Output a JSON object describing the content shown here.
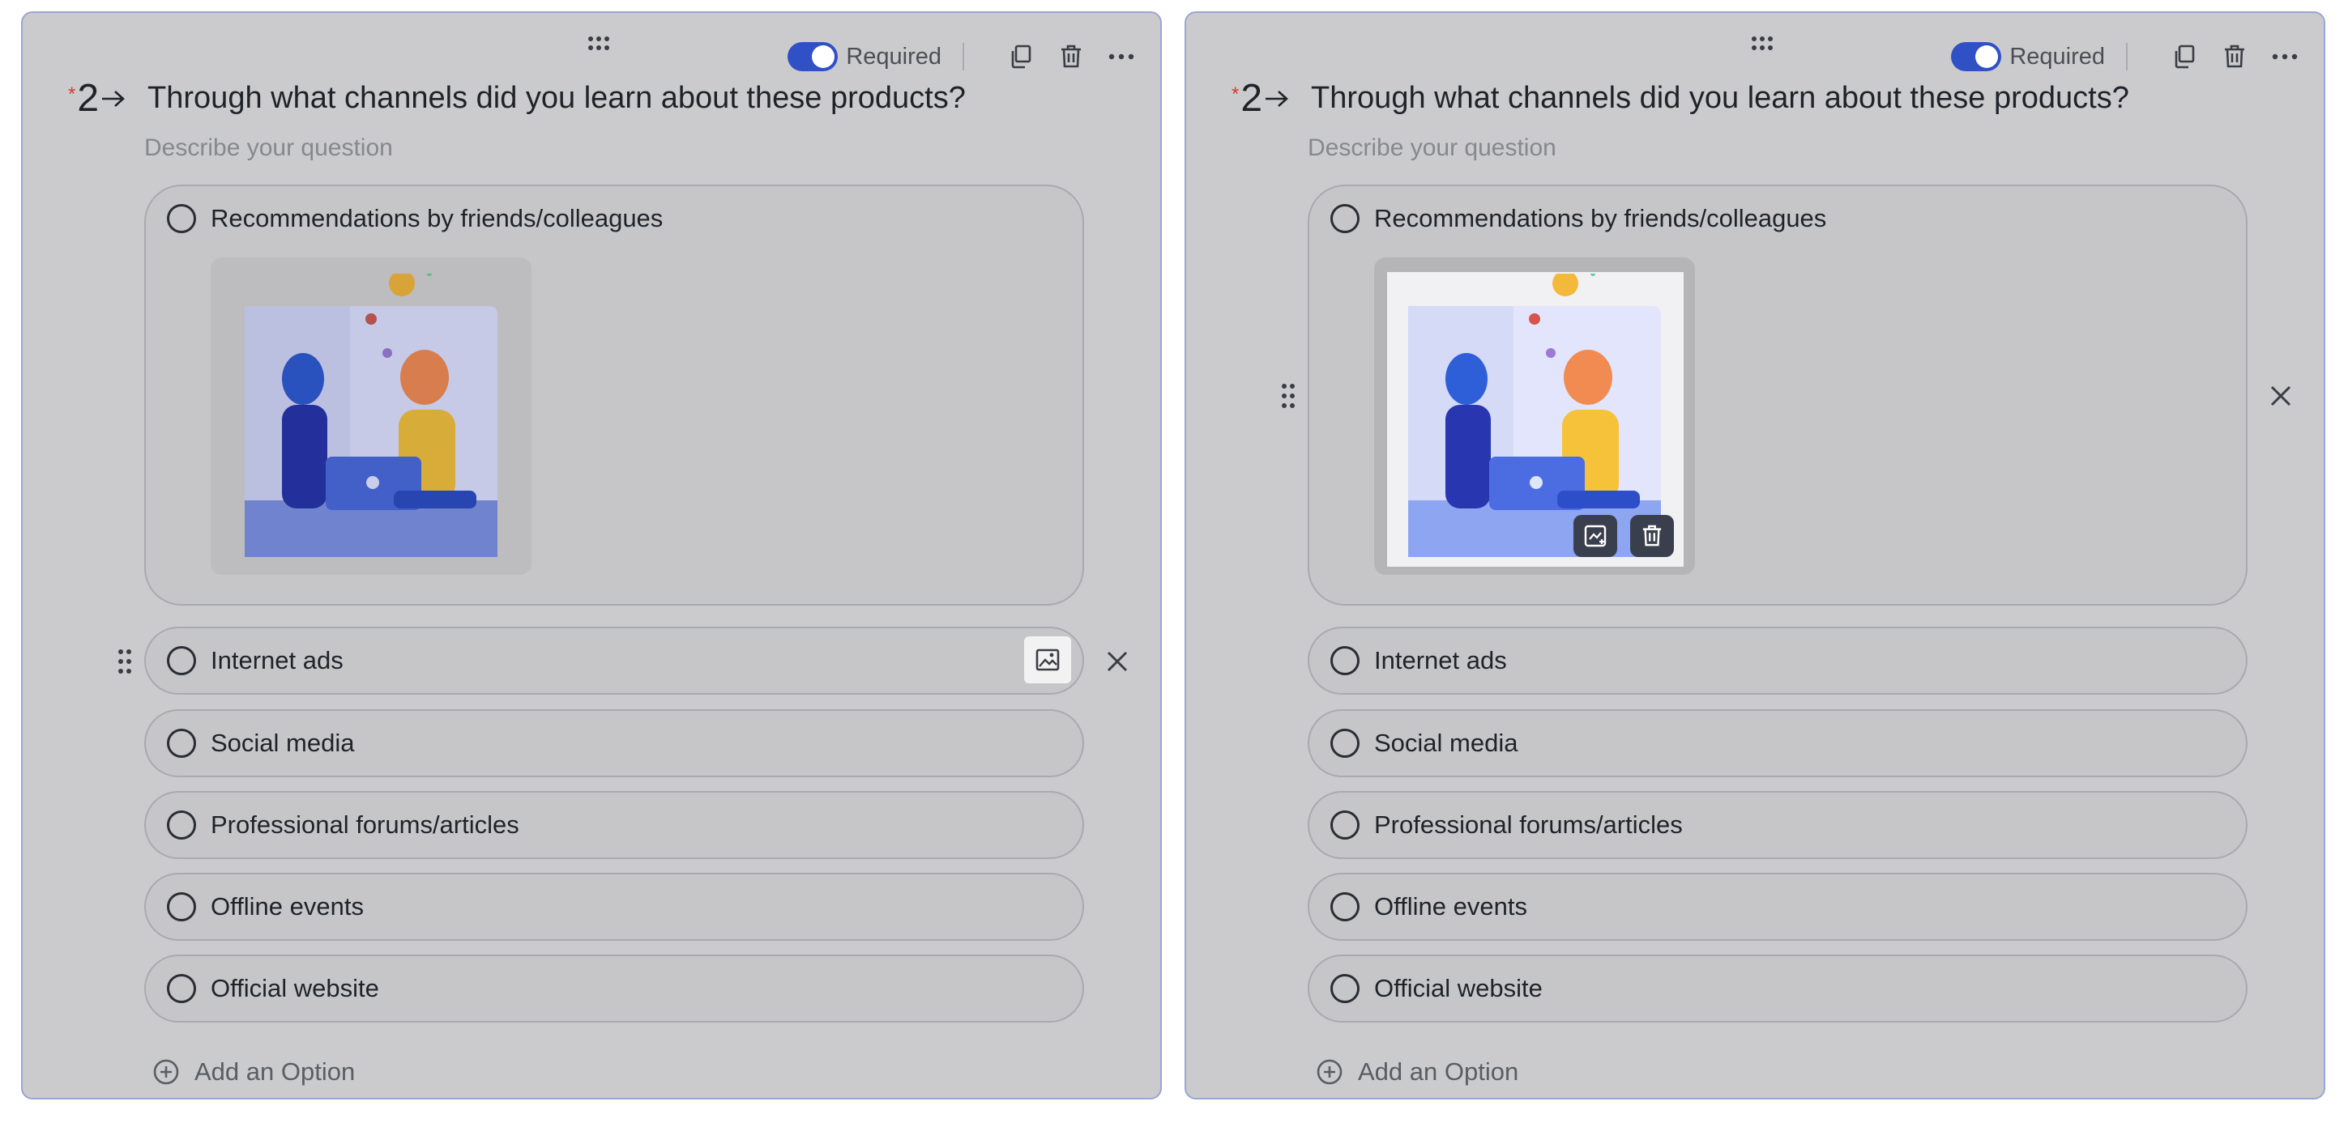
{
  "panels": [
    {
      "required_label": "Required",
      "required_on": true,
      "question_number": "2",
      "question_title": "Through what channels did you learn about these products?",
      "question_description": "Describe your question",
      "options": [
        {
          "label": "Recommendations by friends/colleagues",
          "has_image": true
        },
        {
          "label": "Internet ads",
          "has_image": false
        },
        {
          "label": "Social media",
          "has_image": false
        },
        {
          "label": "Professional forums/articles",
          "has_image": false
        },
        {
          "label": "Offline events",
          "has_image": false
        },
        {
          "label": "Official website",
          "has_image": false
        }
      ],
      "hovered_option": "Internet ads",
      "add_option_label": "Add an Option"
    },
    {
      "required_label": "Required",
      "required_on": true,
      "question_number": "2",
      "question_title": "Through what channels did you learn about these products?",
      "question_description": "Describe your question",
      "options": [
        {
          "label": "Recommendations by friends/colleagues",
          "has_image": true
        },
        {
          "label": "Internet ads",
          "has_image": false
        },
        {
          "label": "Social media",
          "has_image": false
        },
        {
          "label": "Professional forums/articles",
          "has_image": false
        },
        {
          "label": "Offline events",
          "has_image": false
        },
        {
          "label": "Official website",
          "has_image": false
        }
      ],
      "hovered_option": "Recommendations by friends/colleagues",
      "image_tools": [
        "replace-image-icon",
        "delete-image-icon"
      ],
      "add_option_label": "Add an Option"
    }
  ],
  "icons": [
    "drag-handle-icon",
    "copy-icon",
    "trash-icon",
    "more-icon",
    "arrow-right-icon",
    "image-icon",
    "close-icon",
    "plus-circle-icon"
  ],
  "colors": {
    "accent": "#3050c6",
    "required_star": "#d83a32",
    "panel_bg": "#cbcbcd",
    "panel_border": "#9aa6d4"
  }
}
